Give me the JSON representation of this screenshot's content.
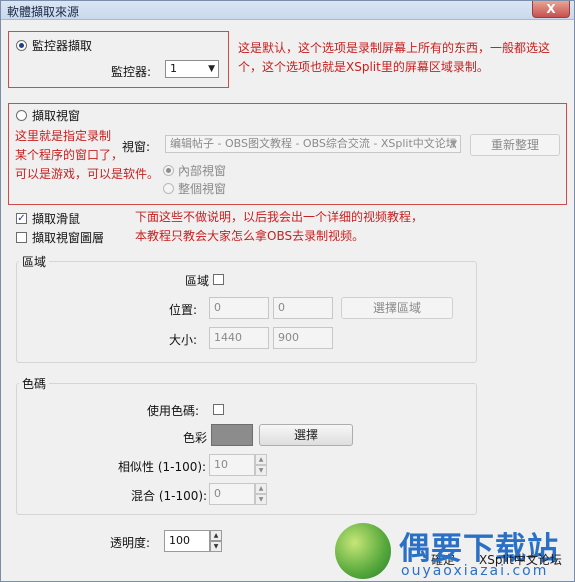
{
  "window": {
    "title": "軟體擷取來源",
    "close": "X"
  },
  "monitor": {
    "radio_label": "監控器擷取",
    "select_label": "監控器:",
    "select_value": "1"
  },
  "note1": {
    "line1": "这是默认，这个选项是录制屏幕上所有的东西，一般都选这",
    "line2": "个，这个选项也就是XSplit里的屏幕区域录制。"
  },
  "window_capture": {
    "radio_label": "擷取視窗",
    "note_lines": [
      "这里就是指定录制",
      "某个程序的窗口了，",
      "可以是游戏，可以是软件。"
    ],
    "window_label": "視窗:",
    "window_value": "编辑帖子 - OBS图文教程 - OBS综合交流 - XSplit中文论坛",
    "refresh_button": "重新整理",
    "inner_radio": "內部視窗",
    "whole_radio": "整個視窗"
  },
  "mouse": {
    "label": "擷取滑鼠",
    "checked": true
  },
  "layered": {
    "label": "擷取視窗圖層",
    "checked": false
  },
  "note2": {
    "line1": "下面这些不做说明，以后我会出一个详细的视频教程，",
    "line2": "本教程只教会大家怎么拿OBS去录制视频。"
  },
  "region": {
    "group_label": "區域",
    "checkbox_label": "區域",
    "position_label": "位置:",
    "pos_x": "0",
    "pos_y": "0",
    "select_button": "選擇區域",
    "size_label": "大小:",
    "width": "1440",
    "height": "900"
  },
  "colorkey": {
    "group_label": "色碼",
    "use_label": "使用色碼:",
    "color_label": "色彩",
    "color_value": "#8c8c8c",
    "choose_button": "選擇",
    "similarity_label": "相似性 (1-100):",
    "similarity_value": "10",
    "blend_label": "混合 (1-100):",
    "blend_value": "0"
  },
  "opacity": {
    "label": "透明度:",
    "value": "100"
  },
  "footer": {
    "ok_partial": "確定",
    "site_text": "XSplit中文论坛"
  },
  "watermark": {
    "big": "偶要下载站",
    "small": "ouyaoxiazai.com"
  },
  "colors": {
    "annotation": "#c81f1f",
    "highlight_box": "#d24b4b",
    "watermark_blue": "#2a71c6"
  }
}
